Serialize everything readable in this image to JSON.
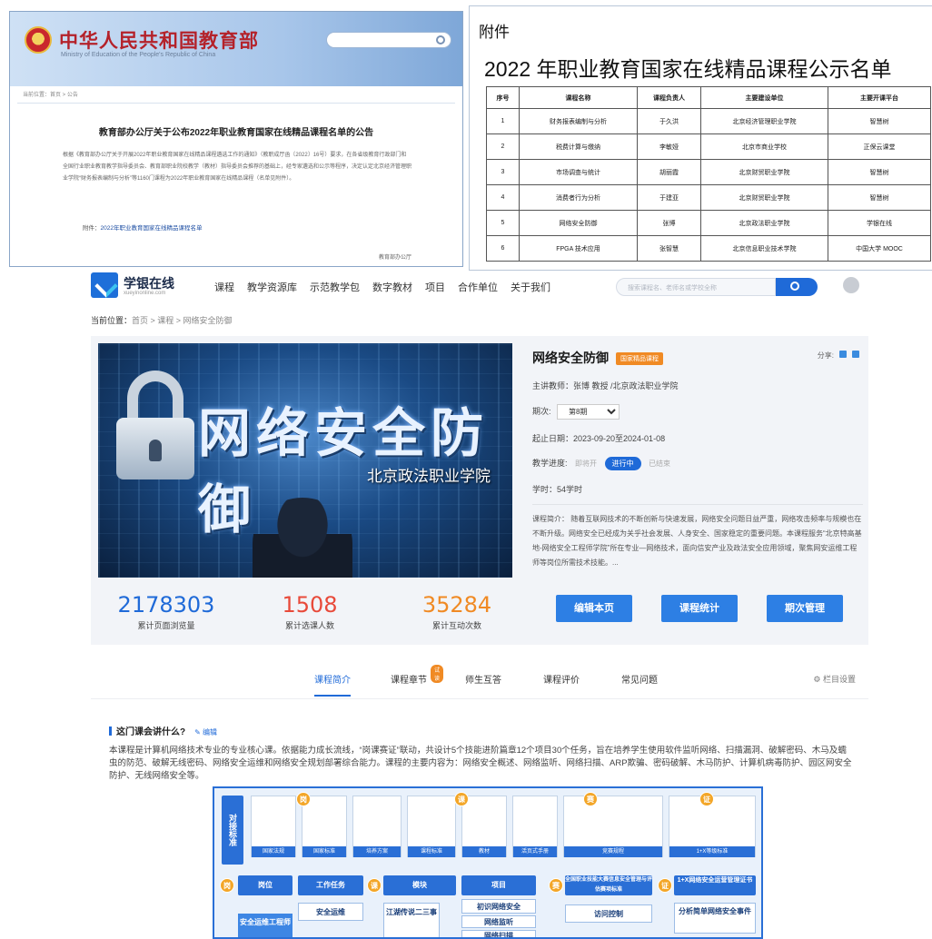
{
  "moe": {
    "title": "中华人民共和国教育部",
    "subtitle": "Ministry of Education of the People's Republic of China",
    "crumb": "当前位置：首页 > 公告",
    "headline": "教育部办公厅关于公布2022年职业教育国家在线精品课程名单的公告",
    "paragraph": "根据《教育部办公厅关于开展2022年职业教育国家在线精品课程遴选工作的通知》（教职成厅函〔2022〕16号）要求，在各省级教育行政部门和全国行业职业教育教学指导委员会、教育部职业院校教学（教材）指导委员会推荐的基础上，经专家遴选和公示等程序，决定认定北京经济管理职业学院“财务报表编制与分析”等1160门课程为2022年职业教育国家在线精品课程（名单见附件）。",
    "attachment_prefix": "附件：",
    "attachment_link": "2022年职业教育国家在线精品课程名单",
    "signature": "教育部办公厅"
  },
  "annex": {
    "label": "附件",
    "title": "2022 年职业教育国家在线精品课程公示名单",
    "headers": [
      "序号",
      "课程名称",
      "课程负责人",
      "主要建设单位",
      "主要开课平台"
    ],
    "rows": [
      [
        "1",
        "财务报表编制与分析",
        "于久洪",
        "北京经济管理职业学院",
        "智慧树"
      ],
      [
        "2",
        "税费计算与缴纳",
        "李敏娅",
        "北京市商业学校",
        "正保云课堂"
      ],
      [
        "3",
        "市场调查与统计",
        "胡丽霞",
        "北京财贸职业学院",
        "智慧树"
      ],
      [
        "4",
        "消费者行为分析",
        "于建亚",
        "北京财贸职业学院",
        "智慧树"
      ],
      [
        "5",
        "网络安全防御",
        "张博",
        "北京政法职业学院",
        "学银在线"
      ],
      [
        "6",
        "FPGA 技术应用",
        "张智慧",
        "北京信息职业技术学院",
        "中国大学 MOOC"
      ]
    ]
  },
  "site": {
    "brand": "学银在线",
    "brand_sub": "xueyinonline.com",
    "menu": [
      "课程",
      "教学资源库",
      "示范教学包",
      "数字教材",
      "项目",
      "合作单位",
      "关于我们"
    ],
    "search_placeholder": "搜索课程名、老师名或学校全称"
  },
  "breadcrumb": {
    "prefix": "当前位置：",
    "path": "首页 > 课程 > 网络安全防御"
  },
  "course": {
    "cover_title": "网络安全防御",
    "cover_school": "北京政法职业学院",
    "title": "网络安全防御",
    "tag": "国家精品课程",
    "share": "分享:",
    "teacher": "主讲教师：张博 教授 /北京政法职业学院",
    "term_label": "期次:",
    "term_value": "第8期",
    "dates": "起止日期：2023-09-20至2024-01-08",
    "progress_label": "教学进度:",
    "progress_states": [
      "即将开",
      "进行中",
      "已结束"
    ],
    "hours": "学时：54学时",
    "description": "课程简介： 随着互联网技术的不断创新与快速发展，网络安全问题日益严重，网络攻击频率与规模也在不断升级。网络安全已经成为关乎社会发展、人身安全、国家稳定的重要问题。本课程服务“北京特高基地-网络安全工程师学院”所在专业—网络技术，面向信安产业及政法安全应用领域，聚焦网安运维工程师等岗位所需技术技能。...",
    "stats": [
      {
        "value": "2178303",
        "label": "累计页面浏览量",
        "color": "#1f6ad8"
      },
      {
        "value": "1508",
        "label": "累计选课人数",
        "color": "#e84a3a"
      },
      {
        "value": "35284",
        "label": "累计互动次数",
        "color": "#f08a24"
      }
    ],
    "buttons": [
      "编辑本页",
      "课程统计",
      "期次管理"
    ]
  },
  "tabs": {
    "items": [
      "课程简介",
      "课程章节",
      "师生互答",
      "课程评价",
      "常见问题"
    ],
    "badge": "试读",
    "settings": "栏目设置"
  },
  "intro": {
    "heading": "这门课会讲什么?",
    "edit": "编辑",
    "body": "本课程是计算机网络技术专业的专业核心课。依据能力成长流线，“岗课赛证”联动，共设计5个技能进阶篇章12个项目30个任务，旨在培养学生使用软件监听网络、扫描漏洞、破解密码、木马及蠕虫的防范、破解无线密码、网络安全运维和网络安全规划部署综合能力。课程的主要内容为：网络安全概述、网络监听、网络扫描、ARP欺骗、密码破解、木马防护、计算机病毒防护、园区网安全防护、无线网络安全等。"
  },
  "diagram": {
    "side": "对接标准",
    "docs": [
      "国家法规",
      "国家标准",
      "培养方案",
      "课程标准",
      "教材",
      "活页式手册",
      "竞赛规程",
      "1+X等级标准"
    ],
    "markers": [
      "岗",
      "课",
      "赛",
      "证"
    ],
    "headers": [
      "岗位",
      "工作任务",
      "模块",
      "项目",
      "全国职业技能大赛信息安全管理与评估赛项标准",
      "1+X网络安全运营管理证书"
    ],
    "cells": [
      "安全运维工程师",
      "安全运维",
      "江湖传说二三事",
      "初识网络安全",
      "网络监听",
      "网络扫描",
      "访问控制",
      "分析简单网络安全事件"
    ]
  }
}
